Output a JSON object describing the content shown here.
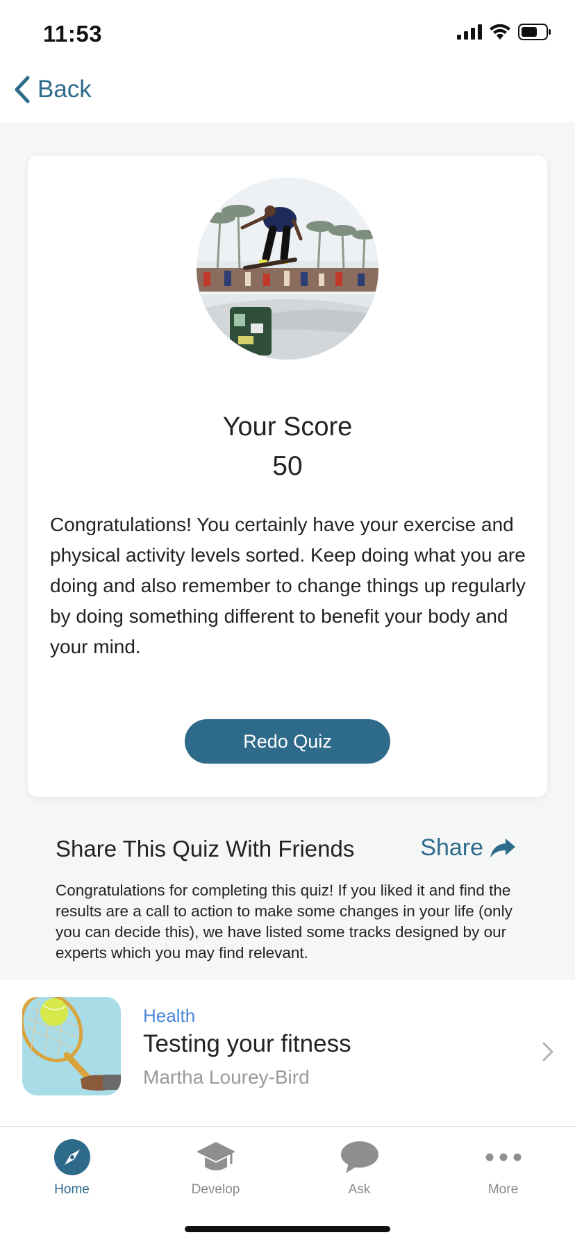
{
  "status_bar": {
    "time": "11:53"
  },
  "nav": {
    "back_label": "Back"
  },
  "result": {
    "score_title": "Your Score",
    "score_value": "50",
    "message": "Congratulations! You certainly have your exercise and physical activity levels sorted. Keep doing what you are doing and also remember to change things up regularly by doing something different to benefit your body and your mind.",
    "redo_label": "Redo Quiz"
  },
  "share": {
    "title": "Share This Quiz With Friends",
    "link_label": "Share",
    "description": "Congratulations for completing this quiz! If you liked it and find the results are a call to action to make some changes in your life (only you can decide this), we have listed some tracks designed by our experts which you may find relevant."
  },
  "track": {
    "category": "Health",
    "title": "Testing your fitness",
    "author": "Martha Lourey-Bird"
  },
  "tabs": [
    {
      "label": "Home",
      "icon": "compass-icon",
      "active": true
    },
    {
      "label": "Develop",
      "icon": "graduation-cap-icon",
      "active": false
    },
    {
      "label": "Ask",
      "icon": "chat-bubble-icon",
      "active": false
    },
    {
      "label": "More",
      "icon": "more-dots-icon",
      "active": false
    }
  ],
  "colors": {
    "accent": "#2e6a8a",
    "category": "#4b86d8",
    "background": "#f5f7f7"
  }
}
